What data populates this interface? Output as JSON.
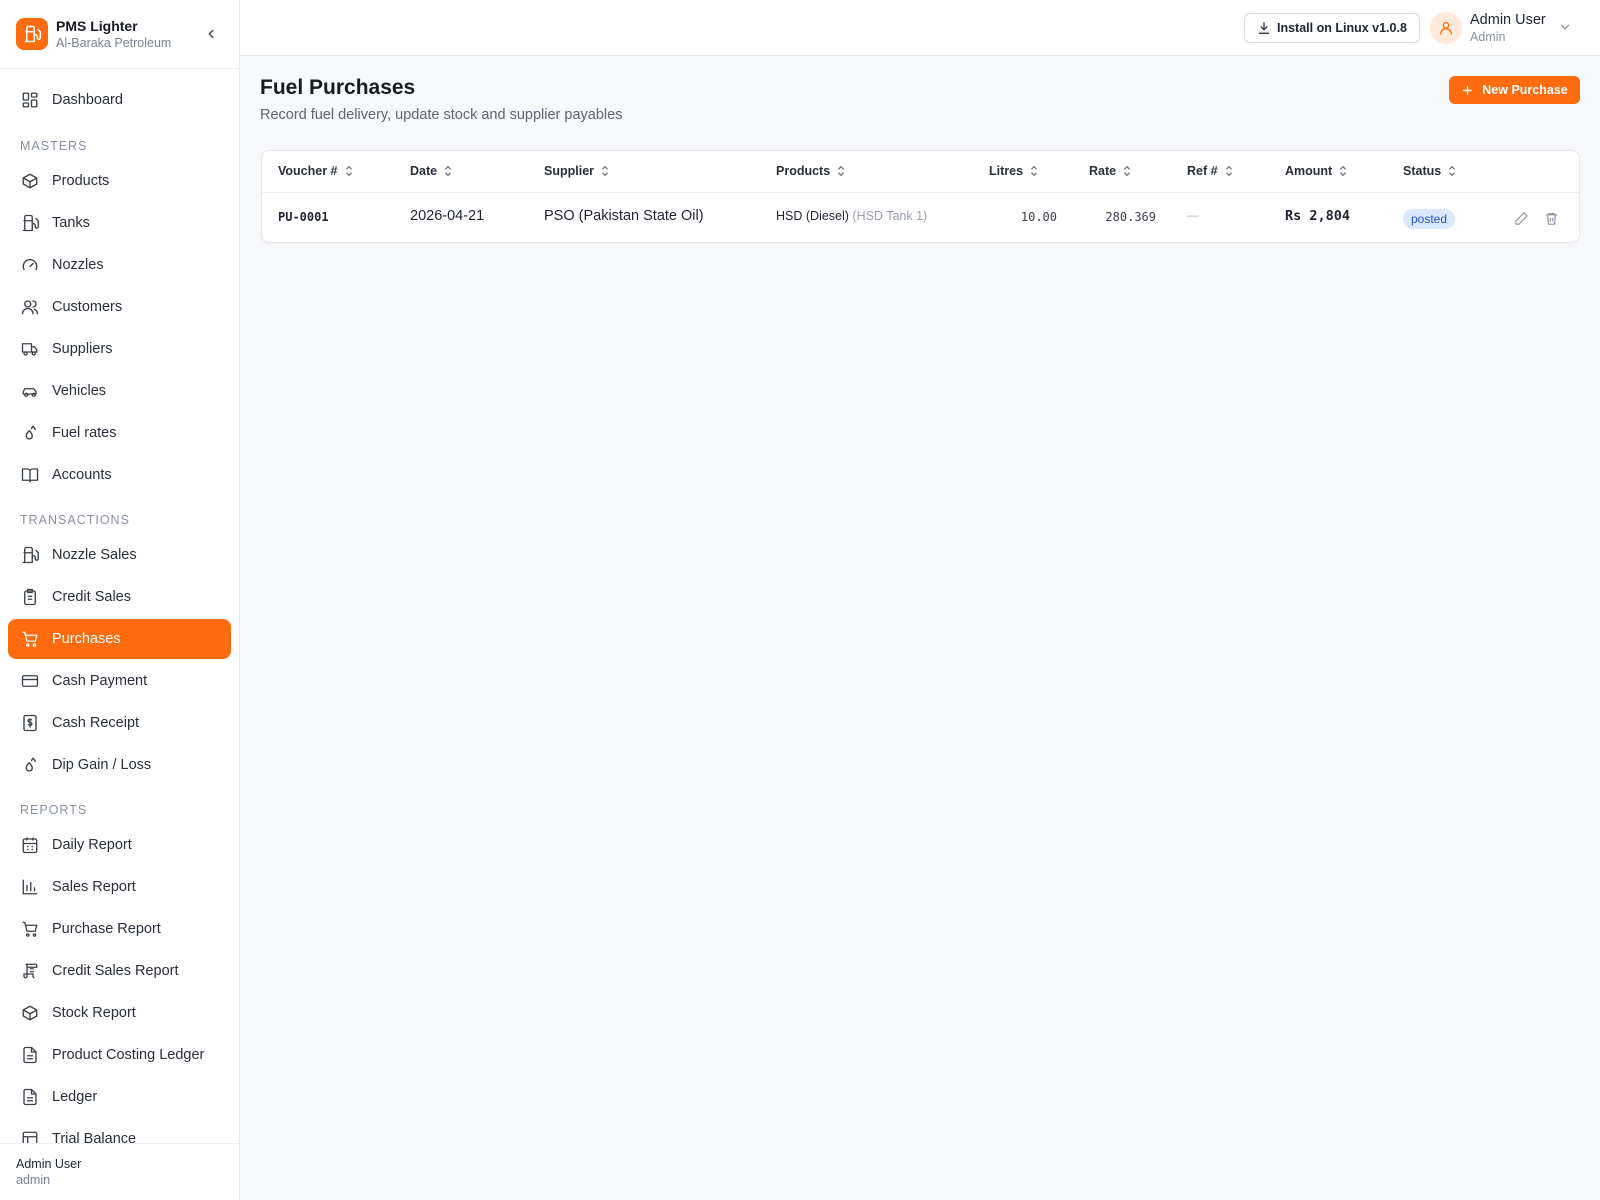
{
  "brand": {
    "title": "PMS Lighter",
    "subtitle": "Al-Baraka Petroleum"
  },
  "nav": {
    "dashboard": "Dashboard",
    "sections": {
      "masters": "MASTERS",
      "transactions": "TRANSACTIONS",
      "reports": "REPORTS"
    },
    "masters": [
      "Products",
      "Tanks",
      "Nozzles",
      "Customers",
      "Suppliers",
      "Vehicles",
      "Fuel rates",
      "Accounts"
    ],
    "transactions": [
      "Nozzle Sales",
      "Credit Sales",
      "Purchases",
      "Cash Payment",
      "Cash Receipt",
      "Dip Gain / Loss"
    ],
    "reports": [
      "Daily Report",
      "Sales Report",
      "Purchase Report",
      "Credit Sales Report",
      "Stock Report",
      "Product Costing Ledger",
      "Ledger",
      "Trial Balance"
    ],
    "active": "Purchases"
  },
  "sidebar_user": {
    "name": "Admin User",
    "role": "admin"
  },
  "topbar": {
    "install_label": "Install on Linux v1.0.8",
    "user_name": "Admin User",
    "user_role": "Admin"
  },
  "page": {
    "title": "Fuel Purchases",
    "subtitle": "Record fuel delivery, update stock and supplier payables",
    "new_button": "New Purchase"
  },
  "table": {
    "columns": [
      "Voucher #",
      "Date",
      "Supplier",
      "Products",
      "Litres",
      "Rate",
      "Ref #",
      "Amount",
      "Status"
    ],
    "rows": [
      {
        "voucher": "PU-0001",
        "date": "2026-04-21",
        "supplier": "PSO (Pakistan State Oil)",
        "product": "HSD (Diesel)",
        "tank": "(HSD Tank 1)",
        "litres": "10.00",
        "rate": "280.369",
        "ref": "—",
        "amount": "Rs 2,804",
        "status": "posted"
      }
    ]
  },
  "colors": {
    "accent": "#ff6b0f",
    "badge_bg": "#dbe9ff",
    "badge_text": "#2456c8"
  }
}
